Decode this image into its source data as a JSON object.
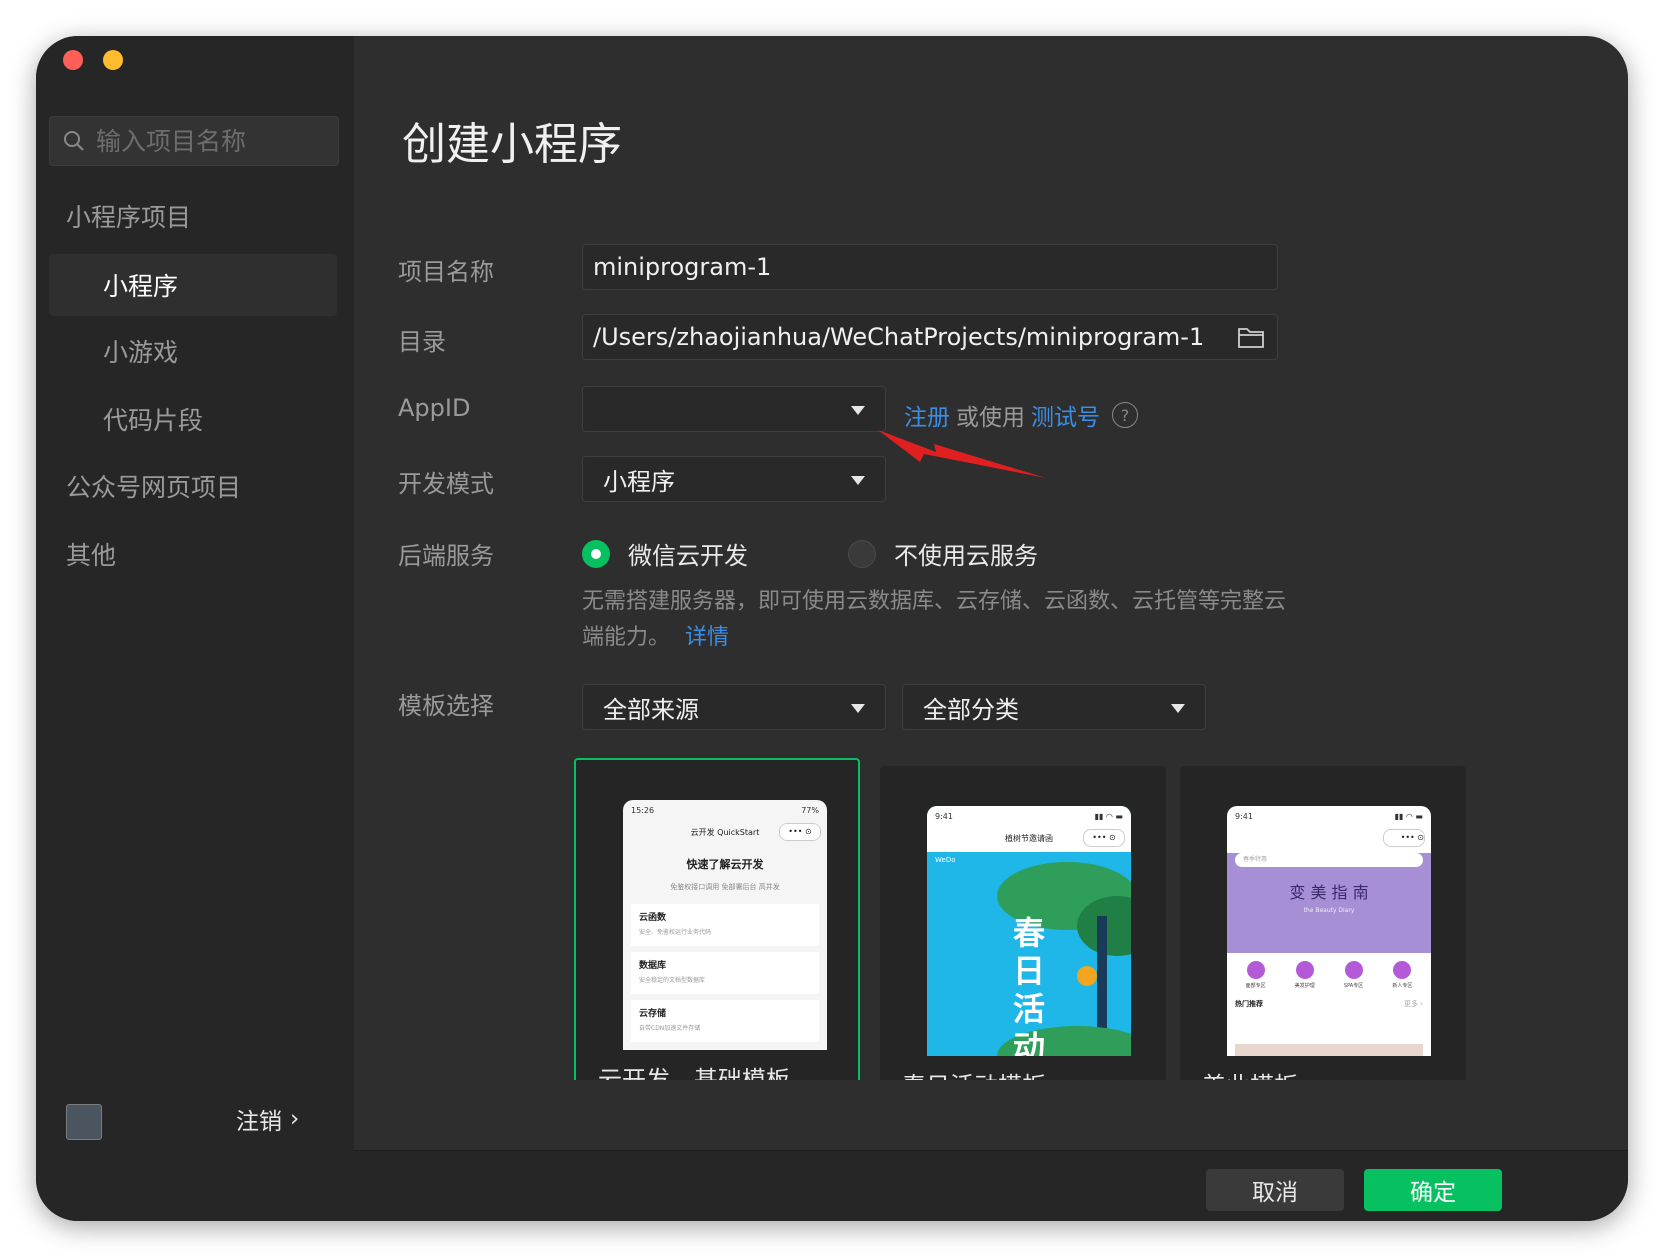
{
  "sidebar": {
    "search_placeholder": "输入项目名称",
    "sections": {
      "miniprogram_project": "小程序项目",
      "official_account": "公众号网页项目",
      "other": "其他"
    },
    "items": [
      {
        "label": "小程序",
        "active": true
      },
      {
        "label": "小游戏",
        "active": false
      },
      {
        "label": "代码片段",
        "active": false
      }
    ],
    "logout_label": "注销",
    "logout_chevron": "›"
  },
  "main": {
    "title": "创建小程序",
    "fields": {
      "project_name_label": "项目名称",
      "project_name_value": "miniprogram-1",
      "directory_label": "目录",
      "directory_value": "/Users/zhaojianhua/WeChatProjects/miniprogram-1",
      "appid_label": "AppID",
      "appid_value": "",
      "register_link": "注册",
      "or_use_text": "或使用",
      "test_account_link": "测试号",
      "help_glyph": "?",
      "dev_mode_label": "开发模式",
      "dev_mode_value": "小程序",
      "backend_label": "后端服务",
      "backend_option_cloud": "微信云开发",
      "backend_option_none": "不使用云服务",
      "backend_selected": "微信云开发",
      "backend_desc": "无需搭建服务器，即可使用云数据库、云存储、云函数、云托管等完整云端能力。",
      "details_link": "详情",
      "template_label": "模板选择",
      "source_select": "全部来源",
      "category_select": "全部分类"
    },
    "templates": [
      {
        "name": "云开发 - 基础模板",
        "selected": true,
        "preview": {
          "time": "15:26",
          "battery": "77%",
          "nav_title": "云开发 QuickStart",
          "heading": "快速了解云开发",
          "subheading": "免鉴权接口调用 免部署后台 高并发",
          "rows": [
            {
              "title": "云函数",
              "sub": "安全、免鉴权运行业务代码"
            },
            {
              "title": "数据库",
              "sub": "安全稳定的文档型数据库"
            },
            {
              "title": "云存储",
              "sub": "自带CDN加速文件存储"
            }
          ]
        }
      },
      {
        "name": "春日活动模板",
        "selected": false,
        "preview": {
          "time": "9:41",
          "nav_title": "植树节邀请函",
          "brand": "WeDo",
          "banner_text": "春日活动"
        }
      },
      {
        "name": "美业模板",
        "selected": false,
        "preview": {
          "time": "9:41",
          "search_placeholder": "春季特惠",
          "banner_title": "变 美 指 南",
          "banner_sub": "the Beauty Diary",
          "categories": [
            "面部专区",
            "美发护理",
            "SPA专区",
            "新人专区"
          ],
          "section": "热门推荐",
          "more": "更多 ›"
        }
      }
    ]
  },
  "footer": {
    "cancel_label": "取消",
    "confirm_label": "确定"
  },
  "colors": {
    "accent_green": "#07c160",
    "link_blue": "#3a8ee6",
    "arrow_red": "#e02020"
  }
}
